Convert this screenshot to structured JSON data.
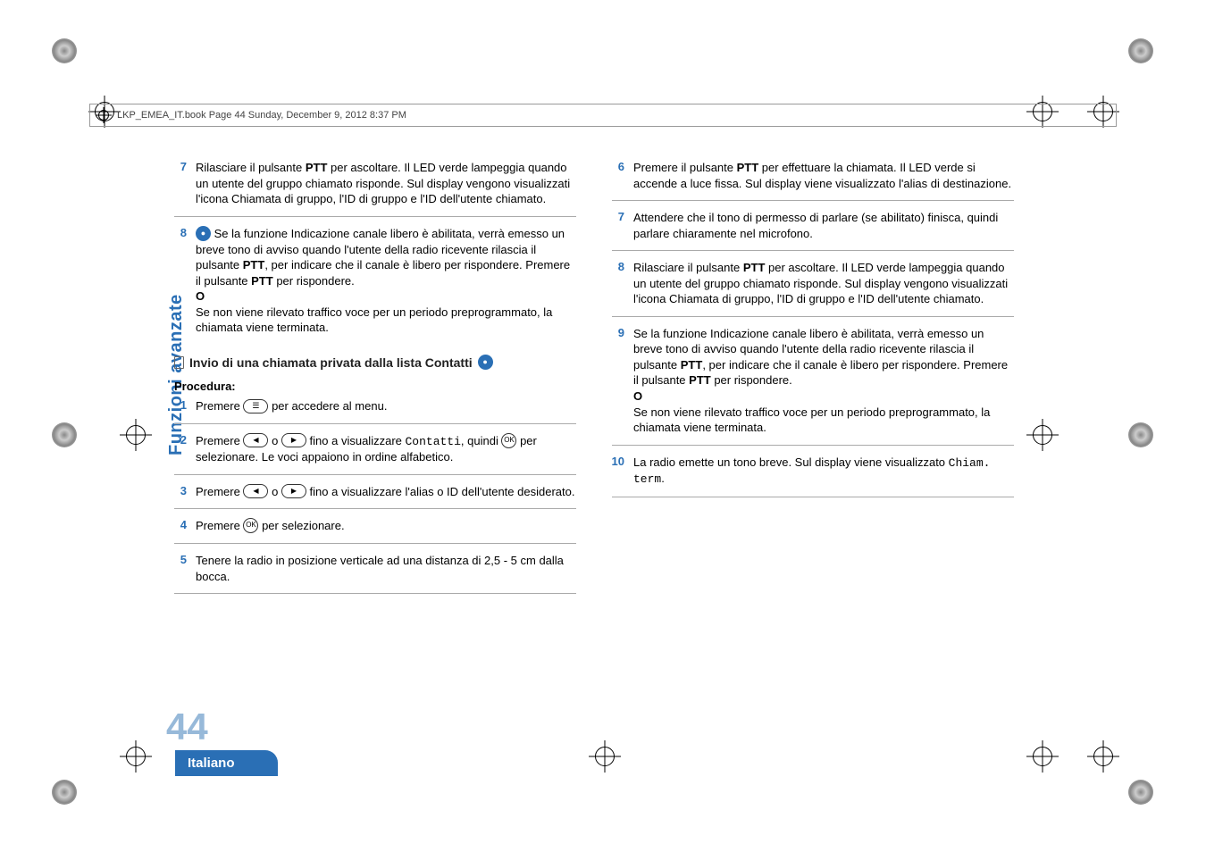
{
  "header": {
    "text": "LKP_EMEA_IT.book  Page 44  Sunday, December 9, 2012  8:37 PM"
  },
  "left": {
    "s7a": "Rilasciare il pulsante ",
    "s7b": "PTT",
    "s7c": " per ascoltare. Il LED verde lampeggia quando un utente del gruppo chiamato risponde. Sul display vengono visualizzati l'icona Chiamata di gruppo, l'ID di gruppo e l'ID dell'utente chiamato.",
    "s8a": "Se la funzione Indicazione canale libero è abilitata, verrà emesso un breve tono di avviso quando l'utente della radio ricevente rilascia il pulsante ",
    "s8b": "PTT",
    "s8c": ", per indicare che il canale è libero per rispondere. Premere il pulsante ",
    "s8d": "PTT",
    "s8e": " per rispondere.",
    "s8O": "O",
    "s8f": "Se non viene rilevato traffico voce per un periodo preprogrammato, la chiamata viene terminata.",
    "sectionTitle": "Invio di una chiamata privata dalla lista Contatti",
    "procLabel": "Procedura:",
    "p1a": "Premere ",
    "p1b": " per accedere al menu.",
    "p2a": "Premere ",
    "p2b": " o ",
    "p2c": " fino a visualizzare ",
    "p2mono": "Contatti",
    "p2d": ", quindi ",
    "p2e": " per selezionare. Le voci appaiono in ordine alfabetico.",
    "p3a": "Premere ",
    "p3b": " o ",
    "p3c": " fino a visualizzare l'alias o ID dell'utente desiderato.",
    "p4a": "Premere ",
    "p4b": " per selezionare.",
    "p5": "Tenere la radio in posizione verticale ad una distanza di 2,5 - 5 cm dalla bocca."
  },
  "right": {
    "s6a": "Premere il pulsante ",
    "s6b": "PTT",
    "s6c": " per effettuare la chiamata. Il LED verde si accende a luce fissa. Sul display viene visualizzato l'alias di destinazione.",
    "s7": "Attendere che il tono di permesso di parlare (se abilitato) finisca, quindi parlare chiaramente nel microfono.",
    "s8a": "Rilasciare il pulsante ",
    "s8b": "PTT",
    "s8c": " per ascoltare. Il LED verde lampeggia quando un utente del gruppo chiamato risponde. Sul display vengono visualizzati l'icona Chiamata di gruppo, l'ID di gruppo e l'ID dell'utente chiamato.",
    "s9a": "Se la funzione Indicazione canale libero è abilitata, verrà emesso un breve tono di avviso quando l'utente della radio ricevente rilascia il pulsante ",
    "s9b": "PTT",
    "s9c": ", per indicare che il canale è libero per rispondere. Premere il pulsante ",
    "s9d": "PTT",
    "s9e": " per rispondere.",
    "s9O": "O",
    "s9f": "Se non viene rilevato traffico voce per un periodo preprogrammato, la chiamata viene terminata.",
    "s10a": "La radio emette un tono breve. Sul display viene visualizzato ",
    "s10mono": "Chiam. term",
    "s10b": "."
  },
  "nums": {
    "n1": "1",
    "n2": "2",
    "n3": "3",
    "n4": "4",
    "n5": "5",
    "n6": "6",
    "n7": "7",
    "n8": "8",
    "n9": "9",
    "n10": "10"
  },
  "okLabel": "OK",
  "sideTab": "Funzioni avanzate",
  "pageNum": "44",
  "langTab": "Italiano"
}
